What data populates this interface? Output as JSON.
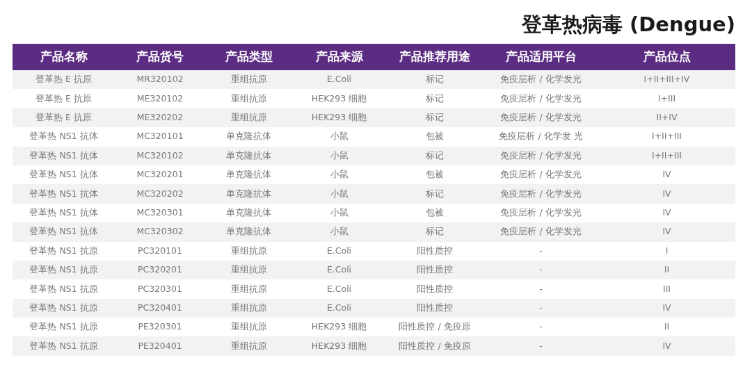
{
  "title": "登革热病毒 (Dengue)",
  "table": {
    "columns": [
      "产品名称",
      "产品货号",
      "产品类型",
      "产品来源",
      "产品推荐用途",
      "产品适用平台",
      "产品位点"
    ],
    "rows": [
      [
        "登革热 E 抗原",
        "MR320102",
        "重组抗原",
        "E.Coli",
        "标记",
        "免疫层析 / 化学发光",
        "I+II+III+IV"
      ],
      [
        "登革热 E 抗原",
        "ME320102",
        "重组抗原",
        "HEK293 细胞",
        "标记",
        "免疫层析 / 化学发光",
        "I+III"
      ],
      [
        "登革热 E 抗原",
        "ME320202",
        "重组抗原",
        "HEK293 细胞",
        "标记",
        "免疫层析 / 化学发光",
        "II+IV"
      ],
      [
        "登革热 NS1 抗体",
        "MC320101",
        "单克隆抗体",
        "小鼠",
        "包被",
        "免疫层析 / 化学发 光",
        "I+II+III"
      ],
      [
        "登革热 NS1 抗体",
        "MC320102",
        "单克隆抗体",
        "小鼠",
        "标记",
        "免疫层析 / 化学发光",
        "I+II+III"
      ],
      [
        "登革热 NS1 抗体",
        "MC320201",
        "单克隆抗体",
        "小鼠",
        "包被",
        "免疫层析 / 化学发光",
        "IV"
      ],
      [
        "登革热 NS1 抗体",
        "MC320202",
        "单克隆抗体",
        "小鼠",
        "标记",
        "免疫层析 / 化学发光",
        "IV"
      ],
      [
        "登革热 NS1 抗体",
        "MC320301",
        "单克隆抗体",
        "小鼠",
        "包被",
        "免疫层析 / 化学发光",
        "IV"
      ],
      [
        "登革热 NS1 抗体",
        "MC320302",
        "单克隆抗体",
        "小鼠",
        "标记",
        "免疫层析 / 化学发光",
        "IV"
      ],
      [
        "登革热 NS1 抗原",
        "PC320101",
        "重组抗原",
        "E.Coli",
        "阳性质控",
        "-",
        "I"
      ],
      [
        "登革热 NS1 抗原",
        "PC320201",
        "重组抗原",
        "E.Coli",
        "阳性质控",
        "-",
        "II"
      ],
      [
        "登革热 NS1 抗原",
        "PC320301",
        "重组抗原",
        "E.Coli",
        "阳性质控",
        "-",
        "III"
      ],
      [
        "登革热 NS1 抗原",
        "PC320401",
        "重组抗原",
        "E.Coli",
        "阳性质控",
        "-",
        "IV"
      ],
      [
        "登革热 NS1 抗原",
        "PE320301",
        "重组抗原",
        "HEK293 细胞",
        "阳性质控 / 免疫原",
        "-",
        "II"
      ],
      [
        "登革热 NS1 抗原",
        "PE320401",
        "重组抗原",
        "HEK293 细胞",
        "阳性质控 / 免疫原",
        "-",
        "IV"
      ]
    ]
  }
}
